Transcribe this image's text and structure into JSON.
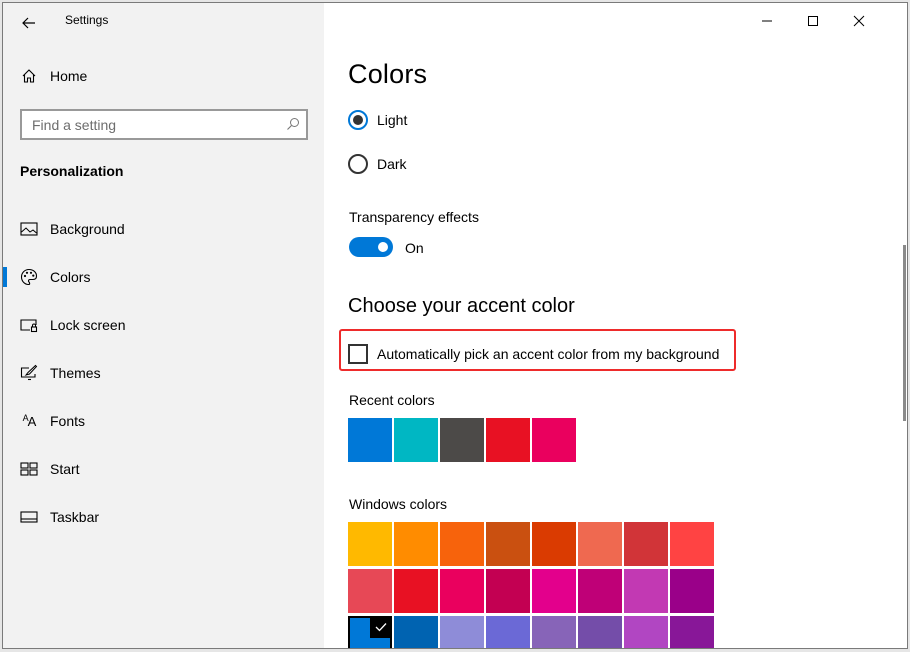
{
  "window": {
    "title": "Settings",
    "controls": {
      "minimize": "minimize-icon",
      "maximize": "maximize-icon",
      "close": "close-icon"
    }
  },
  "sidebar": {
    "home_label": "Home",
    "search": {
      "placeholder": "Find a setting",
      "value": ""
    },
    "section_title": "Personalization",
    "items": [
      {
        "label": "Background",
        "icon": "picture-icon",
        "active": false
      },
      {
        "label": "Colors",
        "icon": "palette-icon",
        "active": true
      },
      {
        "label": "Lock screen",
        "icon": "lock-screen-icon",
        "active": false
      },
      {
        "label": "Themes",
        "icon": "themes-icon",
        "active": false
      },
      {
        "label": "Fonts",
        "icon": "fonts-icon",
        "active": false
      },
      {
        "label": "Start",
        "icon": "start-icon",
        "active": false
      },
      {
        "label": "Taskbar",
        "icon": "taskbar-icon",
        "active": false
      }
    ]
  },
  "main": {
    "title": "Colors",
    "mode_options": [
      {
        "label": "Light",
        "checked": true
      },
      {
        "label": "Dark",
        "checked": false
      }
    ],
    "transparency": {
      "label": "Transparency effects",
      "state_label": "On",
      "on": true
    },
    "accent_heading": "Choose your accent color",
    "auto_pick": {
      "label": "Automatically pick an accent color from my background",
      "checked": false
    },
    "recent_colors": {
      "label": "Recent colors",
      "colors": [
        "#0078d7",
        "#00b7c3",
        "#4c4a48",
        "#e81123",
        "#ea005e"
      ]
    },
    "windows_colors": {
      "label": "Windows colors",
      "rows": [
        [
          "#ffb900",
          "#ff8c00",
          "#f7630c",
          "#ca5010",
          "#da3b01",
          "#ef6950",
          "#d13438",
          "#ff4343"
        ],
        [
          "#e74856",
          "#e81123",
          "#ea005e",
          "#c30052",
          "#e3008c",
          "#bf0077",
          "#c239b3",
          "#9a0089"
        ],
        [
          "#0078d7",
          "#0063b1",
          "#8e8cd8",
          "#6b69d6",
          "#8764b8",
          "#744da9",
          "#b146c2",
          "#881798"
        ]
      ],
      "selected": "#0078d7"
    }
  }
}
